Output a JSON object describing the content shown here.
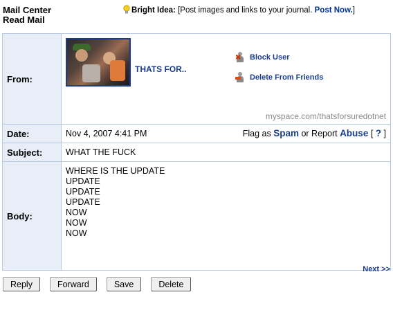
{
  "header": {
    "title_line1": "Mail Center",
    "title_line2": "Read Mail"
  },
  "bright_idea": {
    "label": "Bright Idea:",
    "text": "[Post images and links to your journal.",
    "link": "Post Now.",
    "close": "]"
  },
  "from": {
    "label": "From:",
    "username": "THATS FOR..",
    "actions": [
      "Block User",
      "Delete From Friends"
    ],
    "profile_url": "myspace.com/thatsforsuredotnet"
  },
  "date": {
    "label": "Date:",
    "value": "Nov 4, 2007 4:41 PM",
    "flag_prefix": "Flag as",
    "spam": "Spam",
    "report_mid": "or Report",
    "abuse": "Abuse",
    "help_open": "[",
    "help": "?",
    "help_close": "]"
  },
  "subject": {
    "label": "Subject:",
    "value": "WHAT THE FUCK"
  },
  "body": {
    "label": "Body:",
    "lines": [
      "WHERE IS THE UPDATE",
      "UPDATE",
      "UPDATE",
      "UPDATE",
      "NOW",
      "NOW",
      "NOW"
    ]
  },
  "nav": {
    "next": "Next >>"
  },
  "buttons": {
    "reply": "Reply",
    "forward": "Forward",
    "save": "Save",
    "delete": "Delete"
  },
  "colors": {
    "link": "#1a3c8c",
    "label_bg": "#e7eef8",
    "border": "#b7c9e2"
  }
}
